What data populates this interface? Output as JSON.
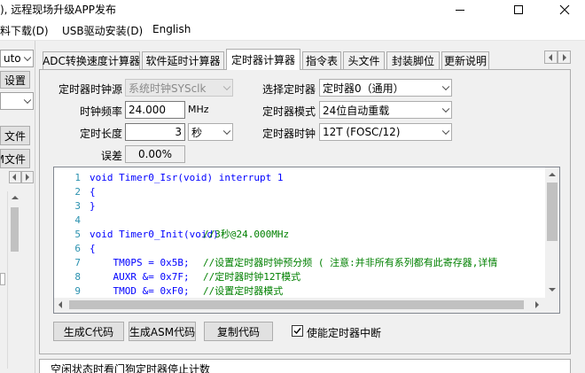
{
  "window": {
    "title": "), 远程现场升级APP发布"
  },
  "menu": {
    "items": [
      "料下载(D)",
      "USB驱动安装(D)",
      "English"
    ]
  },
  "left_panel": {
    "combo_value": "uto",
    "button1": "设置",
    "file1": "文件",
    "file2": "M文件"
  },
  "tabs": [
    "ADC转换速度计算器",
    "软件延时计算器",
    "定时器计算器",
    "指令表",
    "头文件",
    "封装脚位",
    "更新说明"
  ],
  "active_tab": "定时器计算器",
  "form": {
    "clock_source_label": "定时器时钟源",
    "clock_source_value": "系统时钟SYSclk",
    "freq_label": "时钟频率",
    "freq_value": "24.000",
    "freq_unit": "MHz",
    "length_label": "定时长度",
    "length_value": "3",
    "length_unit": "秒",
    "error_label": "误差",
    "error_value": "0.00%",
    "timer_select_label": "选择定时器",
    "timer_select_value": "定时器0（通用）",
    "mode_label": "定时器模式",
    "mode_value": "24位自动重载",
    "clock_label": "定时器时钟",
    "clock_value": "12T (FOSC/12)"
  },
  "code": {
    "lines": [
      {
        "n": "1",
        "code": "void Timer0_Isr(void) interrupt 1",
        "comment": ""
      },
      {
        "n": "2",
        "code": "{",
        "comment": ""
      },
      {
        "n": "3",
        "code": "}",
        "comment": ""
      },
      {
        "n": "4",
        "code": "",
        "comment": ""
      },
      {
        "n": "5",
        "code": "void Timer0_Init(void)",
        "comment": "//3秒@24.000MHz"
      },
      {
        "n": "6",
        "code": "{",
        "comment": ""
      },
      {
        "n": "7",
        "code": "    TM0PS = 0x5B;",
        "comment": "//设置定时器时钟预分频 ( 注意:并非所有系列都有此寄存器,详情"
      },
      {
        "n": "8",
        "code": "    AUXR &= 0x7F;",
        "comment": "//定时器时钟12T模式"
      },
      {
        "n": "9",
        "code": "    TMOD &= 0xF0;",
        "comment": "//设置定时器模式"
      }
    ]
  },
  "buttons": {
    "gen_c": "生成C代码",
    "gen_asm": "生成ASM代码",
    "copy": "复制代码",
    "enable_int": "使能定时器中断"
  },
  "bottom_text": "空闲状态时看门狗定时器停止计数"
}
